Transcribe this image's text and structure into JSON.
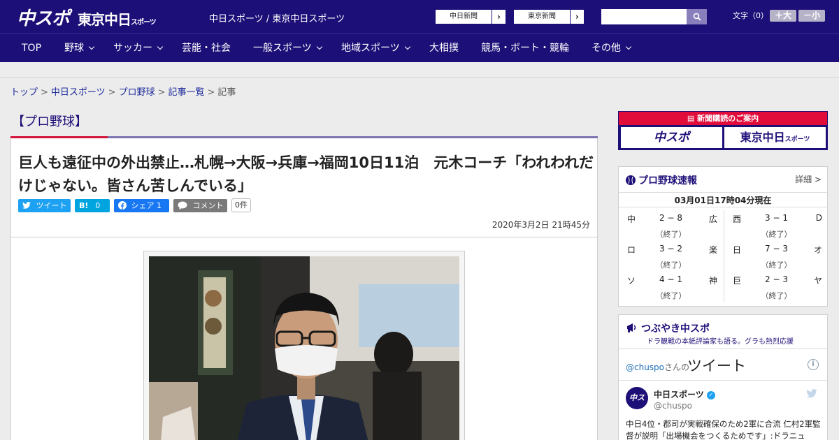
{
  "header": {
    "logo_chuspo": "中スポ",
    "logo_tokyo": "東京中日",
    "logo_tokyo_sub": "スポーツ",
    "site_name": "中日スポーツ / 東京中日スポーツ",
    "btn_chunichi": "中日新聞",
    "btn_tokyo": "東京新聞",
    "search_placeholder": "",
    "font_label": "文字（0）",
    "font_larger": "＋大",
    "font_smaller": "－小"
  },
  "nav": {
    "items": [
      "TOP",
      "野球",
      "サッカー",
      "芸能・社会",
      "一般スポーツ",
      "地域スポーツ",
      "大相撲",
      "競馬・ボート・競輪",
      "その他"
    ]
  },
  "breadcrumb": {
    "items": [
      "トップ",
      "中日スポーツ",
      "プロ野球",
      "記事一覧"
    ],
    "current": "記事",
    "sep": ">"
  },
  "article": {
    "category": "【プロ野球】",
    "headline": "巨人も遠征中の外出禁止…札幌→大阪→兵庫→福岡10日11泊　元木コーチ「われわれだけじゃない。皆さん苦しんでいる」",
    "share_tweet": "ツイート",
    "share_hatena_label": "B!",
    "share_hatena_count": "0",
    "share_fb": "シェア 1",
    "share_comment": "コメント",
    "comment_count": "0件",
    "date": "2020年3月2日 21時45分"
  },
  "sidebar": {
    "subscribe_title": "新聞購読のご案内",
    "subscribe_chuspo": "中スポ",
    "subscribe_tokyo": "東京中日",
    "subscribe_tokyo_sub": "スポーツ",
    "scores_title": "プロ野球速報",
    "scores_more": "詳細 >",
    "scores_time": "03月01日17時04分現在",
    "games_left": [
      {
        "home": "中",
        "score": "2 − 8",
        "away": "広",
        "status": "（終了）"
      },
      {
        "home": "ロ",
        "score": "3 − 2",
        "away": "楽",
        "status": "（終了）"
      },
      {
        "home": "ソ",
        "score": "4 − 1",
        "away": "神",
        "status": "（終了）"
      }
    ],
    "games_right": [
      {
        "home": "西",
        "score": "3 − 1",
        "away": "D",
        "status": "（終了）"
      },
      {
        "home": "日",
        "score": "7 − 3",
        "away": "オ",
        "status": "（終了）"
      },
      {
        "home": "巨",
        "score": "2 − 3",
        "away": "ヤ",
        "status": "（終了）"
      }
    ],
    "twitter_title": "つぶやき中スポ",
    "twitter_sub": "ドラ観戦の本紙評論家も語る。グラも熱烈応援",
    "twitter_handle": "@chuspo",
    "twitter_san": "さんの",
    "twitter_tweet_word": "ツイート",
    "tweet_user": "中日スポーツ",
    "tweet_user_handle": "@chuspo",
    "tweet_avatar": "中スポ",
    "tweet_text": "中日4位・郡司が実戦確保のため2軍に合流 仁村2軍監督が説明「出場機会をつくるためです」:ドラニュ"
  },
  "colors": {
    "brand_navy": "#1d0f78",
    "accent_red": "#d2143a",
    "twitter_blue": "#1da1f2",
    "facebook_blue": "#1877f2",
    "hatena_blue": "#00a4de"
  }
}
